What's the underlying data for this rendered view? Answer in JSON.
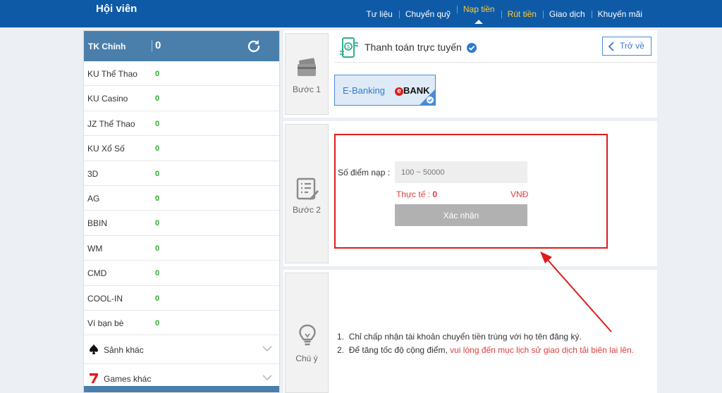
{
  "header": {
    "brand": "Hội viên",
    "nav": [
      {
        "label": "Tư liệu"
      },
      {
        "label": "Chuyển quỹ"
      },
      {
        "label": "Nạp tiền"
      },
      {
        "label": "Rút tiền"
      },
      {
        "label": "Giao dịch"
      },
      {
        "label": "Khuyến mãi"
      }
    ]
  },
  "sidebar": {
    "main_label": "TK Chính",
    "main_value": "0",
    "accounts": [
      {
        "name": "KU Thể Thao",
        "value": "0"
      },
      {
        "name": "KU Casino",
        "value": "0"
      },
      {
        "name": "JZ Thể Thao",
        "value": "0"
      },
      {
        "name": "KU Xổ Số",
        "value": "0"
      },
      {
        "name": "3D",
        "value": "0"
      },
      {
        "name": "AG",
        "value": "0"
      },
      {
        "name": "BBIN",
        "value": "0"
      },
      {
        "name": "WM",
        "value": "0"
      },
      {
        "name": "CMD",
        "value": "0"
      },
      {
        "name": "COOL-IN",
        "value": "0"
      },
      {
        "name": "Ví bạn bè",
        "value": "0"
      }
    ],
    "groups": [
      {
        "label": "Sảnh khác",
        "icon": "spade-icon"
      },
      {
        "label": "Games khác",
        "icon": "seven-icon"
      }
    ]
  },
  "step1": {
    "label": "Bước 1",
    "title": "Thanh toán trực tuyến",
    "back_label": "Trở về",
    "method": {
      "text": "E-Banking",
      "brand_e": "e",
      "brand_bank": "BANK"
    }
  },
  "step2": {
    "label": "Bước 2",
    "field_label": "Số điểm nạp :",
    "placeholder": "100 ~ 50000",
    "actual_label": "Thực tế :",
    "actual_value": "0",
    "unit": "VNĐ",
    "confirm_label": "Xác nhận"
  },
  "notes": {
    "label": "Chú ý",
    "items": [
      {
        "num": "1.",
        "text": "Chỉ chấp nhận tài khoản chuyển tiền trùng với họ tên đăng ký.",
        "highlight": ""
      },
      {
        "num": "2.",
        "text": "Để tăng tốc độ cộng điểm,",
        "highlight": "vui lòng đến mục lịch sử giao dịch tải biên lai lên."
      }
    ]
  },
  "colors": {
    "header_bg": "#0e5aa7",
    "sidebar_head": "#4a7fac",
    "positive": "#2fae2f",
    "alert": "#e01b1b",
    "accent": "#ffcc33"
  }
}
